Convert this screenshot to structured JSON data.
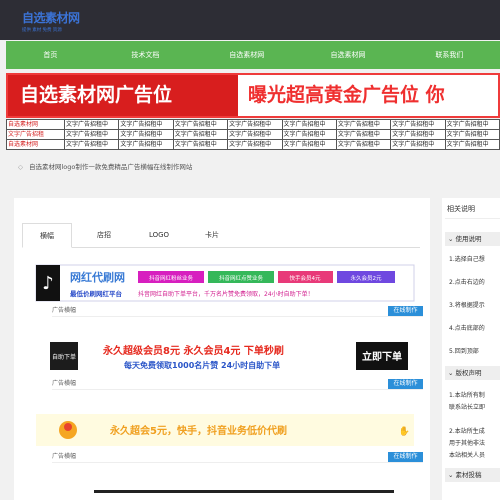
{
  "site": {
    "logo_main": "自选素材网",
    "logo_sub": "提供 素材 免费 资源"
  },
  "nav": {
    "items": [
      "首页",
      "技术文档",
      "自选素材网",
      "自选素材网",
      "联系我们"
    ]
  },
  "ad_banner": {
    "left_text": "自选素材网广告位",
    "right_text": "曝光超高黄金广告位 你"
  },
  "ad_grid": {
    "first_col": [
      "自选素材网",
      "文字广告招租",
      "自选素材网"
    ],
    "cell_text": "文字广告招租中"
  },
  "notice": {
    "text": "自选素材网logo制作一款免费精品广告横幅在线制作网站"
  },
  "tabs": {
    "items": [
      "横幅",
      "店招",
      "LOGO",
      "卡片"
    ],
    "active": "横幅"
  },
  "rows": [
    {
      "label": "广告横幅",
      "button": "在线制作",
      "title": "网红代刷网",
      "subtitle": "最低价刷网红平台",
      "tags": [
        "抖音网红粉丝业务",
        "抖音网红点赞业务",
        "快手会员4元",
        "永久会员2元"
      ],
      "tagline": "抖音网红自助下单平台，千万名片赞免费领取，24小时自助下单！"
    },
    {
      "label": "广告横幅",
      "button": "在线制作",
      "badge": "自助下单",
      "line1": "永久超级会员8元  永久会员4元  下单秒刷",
      "line2": "每天免费领取1000名片赞  24小时自助下单",
      "cta": "立即下单"
    },
    {
      "label": "广告横幅",
      "button": "在线制作",
      "text": "永久超会5元，快手，抖音业务低价代刷"
    }
  ],
  "sidebar": {
    "title": "相关说明",
    "usage_head": "使用说明",
    "usage_items": [
      "1.选择自己想",
      "2.点击右边的",
      "3.将根据提示",
      "4.点击底部的",
      "5.回到顶部"
    ],
    "copyright_head": "版权声明",
    "copyright_items": [
      "1.本站所有制",
      "联系站长立即",
      "2.本站所生成",
      "用于其他非法",
      "本站相关人员"
    ],
    "material_head": "素材投稿"
  },
  "colors": {
    "topbar": "#2d2d35",
    "nav": "#5ab552",
    "accent_red": "#d81e1e",
    "button_blue": "#2b8fd9"
  }
}
